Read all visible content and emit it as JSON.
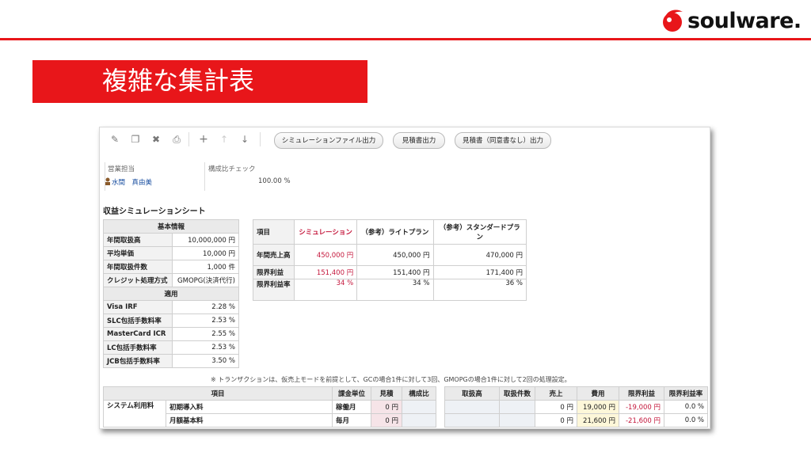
{
  "brand": {
    "name": "soulware.",
    "accent": "#e8161a"
  },
  "slide": {
    "title": "複雑な集計表"
  },
  "toolbar": {
    "icons": [
      "edit-icon",
      "copy-icon",
      "delete-icon",
      "print-icon",
      "add-icon",
      "move-up-icon",
      "move-down-icon"
    ],
    "buttons": [
      "シミュレーションファイル出力",
      "見積書出力",
      "見積書（同意書なし）出力"
    ]
  },
  "meta": {
    "sales_label": "営業担当",
    "sales_name": "水間　真由美",
    "ratio_label": "構成比チェック",
    "ratio_value": "100.00 %"
  },
  "sheet_title": "収益シミュレーションシート",
  "basic": {
    "header": "基本情報",
    "rows": [
      {
        "label": "年間取扱高",
        "value": "10,000,000 円"
      },
      {
        "label": "平均単価",
        "value": "10,000 円"
      },
      {
        "label": "年間取扱件数",
        "value": "1,000 件"
      },
      {
        "label": "クレジット処理方式",
        "value": "GMOPG(決済代行)"
      }
    ],
    "apply_header": "適用",
    "rates": [
      {
        "label": "Visa IRF",
        "value": "2.28 %"
      },
      {
        "label": "SLC包括手数料率",
        "value": "2.53 %"
      },
      {
        "label": "MasterCard ICR",
        "value": "2.55 %"
      },
      {
        "label": "LC包括手数料率",
        "value": "2.53 %"
      },
      {
        "label": "JCB包括手数料率",
        "value": "3.50 %"
      }
    ]
  },
  "compare": {
    "headers": [
      "項目",
      "シミュレーション",
      "（参考）ライトプラン",
      "（参考）スタンダードプラン"
    ],
    "rows": [
      {
        "label": "年間売上高",
        "values": [
          "450,000 円",
          "450,000 円",
          "470,000 円"
        ]
      },
      {
        "label": "限界利益",
        "values": [
          "151,400 円",
          "151,400 円",
          "171,400 円"
        ]
      },
      {
        "label": "限界利益率",
        "values": [
          "34 %",
          "34 %",
          "36 %"
        ]
      }
    ]
  },
  "note": "※ トランザクションは、仮売上モードを前提として、GCの場合1件に対して3回、GMOPGの場合1件に対して2回の処理設定。",
  "detail": {
    "headers": [
      "項目",
      "課金単位",
      "見積",
      "構成比",
      "取扱高",
      "取扱件数",
      "売上",
      "費用",
      "限界利益",
      "限界利益率"
    ],
    "group": "システム利用料",
    "rows": [
      {
        "item": "初期導入料",
        "unit": "稼働月",
        "estimate": "0 円",
        "sales": "0 円",
        "cost": "19,000 円",
        "profit": "-19,000 円",
        "rate": "0.0 %"
      },
      {
        "item": "月額基本料",
        "unit": "毎月",
        "estimate": "0 円",
        "sales": "0 円",
        "cost": "21,600 円",
        "profit": "-21,600 円",
        "rate": "0.0 %"
      }
    ]
  }
}
